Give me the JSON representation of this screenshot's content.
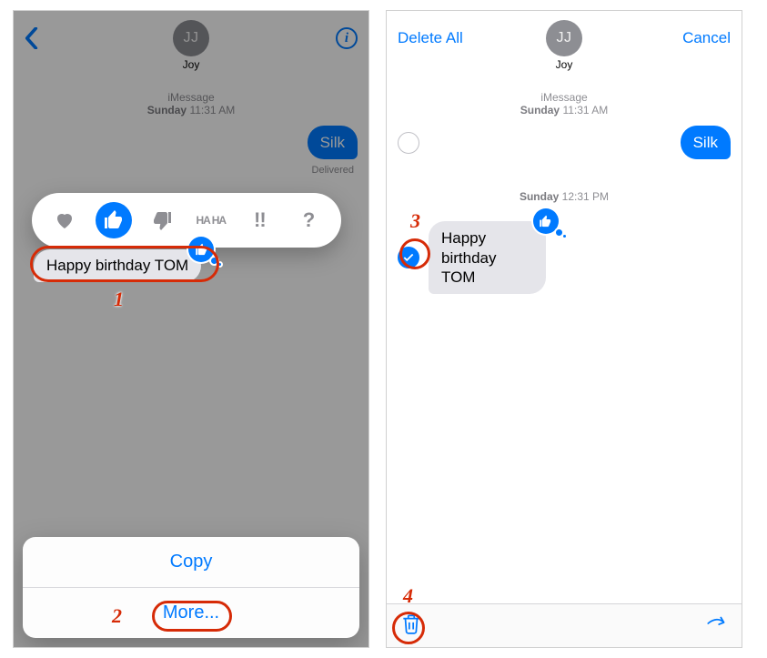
{
  "left": {
    "contact_initials": "JJ",
    "contact_name": "Joy",
    "timestamp_label": "iMessage",
    "timestamp_day": "Sunday",
    "timestamp_time": "11:31 AM",
    "msg_sent_1": "Silk",
    "delivered_label": "Delivered",
    "msg_received_1": "Happy birthday TOM",
    "tapback_haha": "HA HA",
    "tapback_exclaim": "!!",
    "tapback_question": "?",
    "action_copy": "Copy",
    "action_more": "More...",
    "annot_1": "1",
    "annot_2": "2"
  },
  "right": {
    "delete_all": "Delete All",
    "cancel": "Cancel",
    "contact_initials": "JJ",
    "contact_name": "Joy",
    "ts1_label": "iMessage",
    "ts1_day": "Sunday",
    "ts1_time": "11:31 AM",
    "msg_sent_1": "Silk",
    "ts2_day": "Sunday",
    "ts2_time": "12:31 PM",
    "msg_received_1": "Happy birthday TOM",
    "annot_3": "3",
    "annot_4": "4"
  }
}
